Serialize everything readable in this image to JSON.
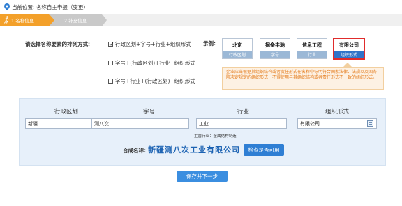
{
  "location": {
    "text": "当前位置: 名称自主申报（变更）"
  },
  "steps": [
    {
      "label": "1.名称信息"
    },
    {
      "label": "2.补充信息"
    }
  ],
  "question": {
    "label": "请选择名称要素的排列方式:"
  },
  "options": [
    {
      "label": "行政区划+字号+行业+组织形式",
      "checked": true
    },
    {
      "label": "字号+(行政区划)+行业+组织形式",
      "checked": false
    },
    {
      "label": "字号+行业+(行政区划)+组织形式",
      "checked": false
    }
  ],
  "example": {
    "label": "示例:",
    "cards": [
      {
        "top": "北京",
        "bottom": "行政区划",
        "selected": false
      },
      {
        "top": "掘金丰驰",
        "bottom": "字号",
        "selected": false
      },
      {
        "top": "信息工程",
        "bottom": "行业",
        "selected": false
      },
      {
        "top": "有限公司",
        "bottom": "组织形式",
        "selected": true
      }
    ]
  },
  "warning": {
    "text": "企业应当根据其组织结构或者责任形式在名称中标明符合国家法律、法规以及国务院决定规定的组织形式，不得使用与其组织结构或者责任形式不一致的组织形式。"
  },
  "columns": {
    "admin": "行政区划",
    "brand": "字号",
    "industry": "行业",
    "org": "组织形式"
  },
  "fields": {
    "admin": "新疆",
    "brand": "测八次",
    "industry": "工业",
    "org": "有限公司"
  },
  "main_industry": {
    "text": "主营行业：金属结构制造"
  },
  "combined": {
    "label": "合成名称:",
    "name": "新疆测八次工业有限公司"
  },
  "buttons": {
    "check": "检查是否可用",
    "save": "保存并下一步"
  },
  "colors": {
    "accent": "#f3a02a",
    "primary": "#2f7fd4",
    "warning_text": "#e47b1b",
    "selected_border": "#e02c2c"
  }
}
